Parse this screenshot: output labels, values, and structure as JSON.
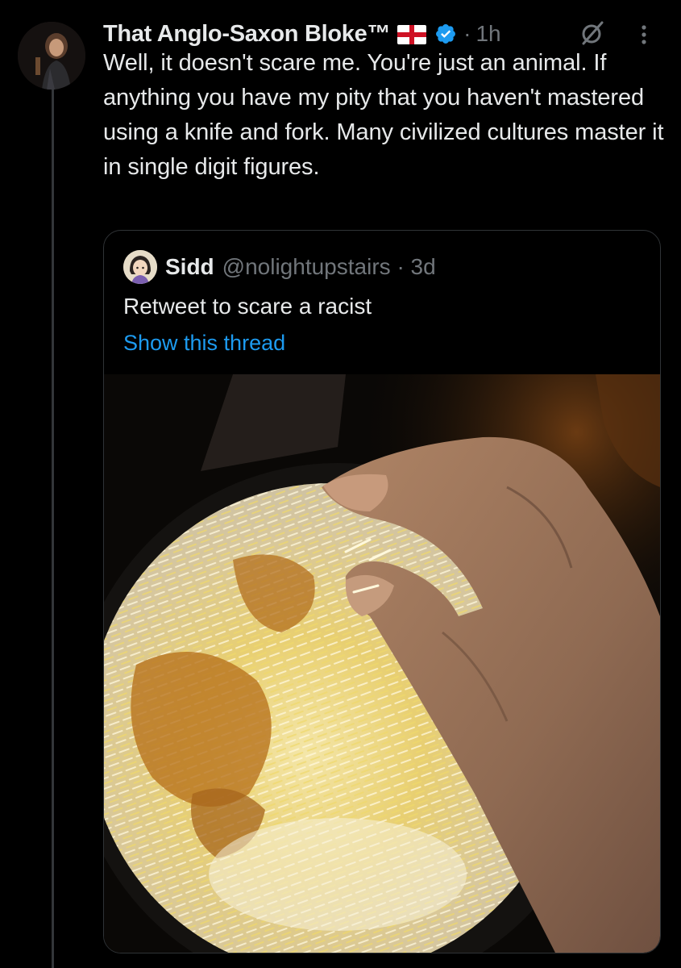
{
  "tweet": {
    "author": {
      "display_name": "That Anglo-Saxon Bloke™",
      "flag_emoji": "🏴󠁧󠁢󠁥󠁮󠁧󠁿",
      "verified": true
    },
    "time_separator": "·",
    "time": "1h",
    "text": "Well, it doesn't scare me. You're just an animal. If anything you have my pity that you haven't mastered using a knife and fork. Many civilized cultures master it in single digit figures.",
    "icons": {
      "verified": "verified-badge-icon",
      "grok": "grok-icon",
      "more": "more-options-icon"
    }
  },
  "quoted_tweet": {
    "author": {
      "display_name": "Sidd",
      "handle": "@nolightupstairs"
    },
    "time_separator": "·",
    "time": "3d",
    "text": "Retweet to scare a racist",
    "show_thread_label": "Show this thread",
    "media": {
      "kind": "photo",
      "subject": "hand eating biryani from a black bowl"
    }
  },
  "colors": {
    "background": "#000000",
    "text_primary": "#e7e9ea",
    "text_secondary": "#71767b",
    "link": "#1d9bf0",
    "verified": "#1d9bf0",
    "border": "#2f3336"
  }
}
